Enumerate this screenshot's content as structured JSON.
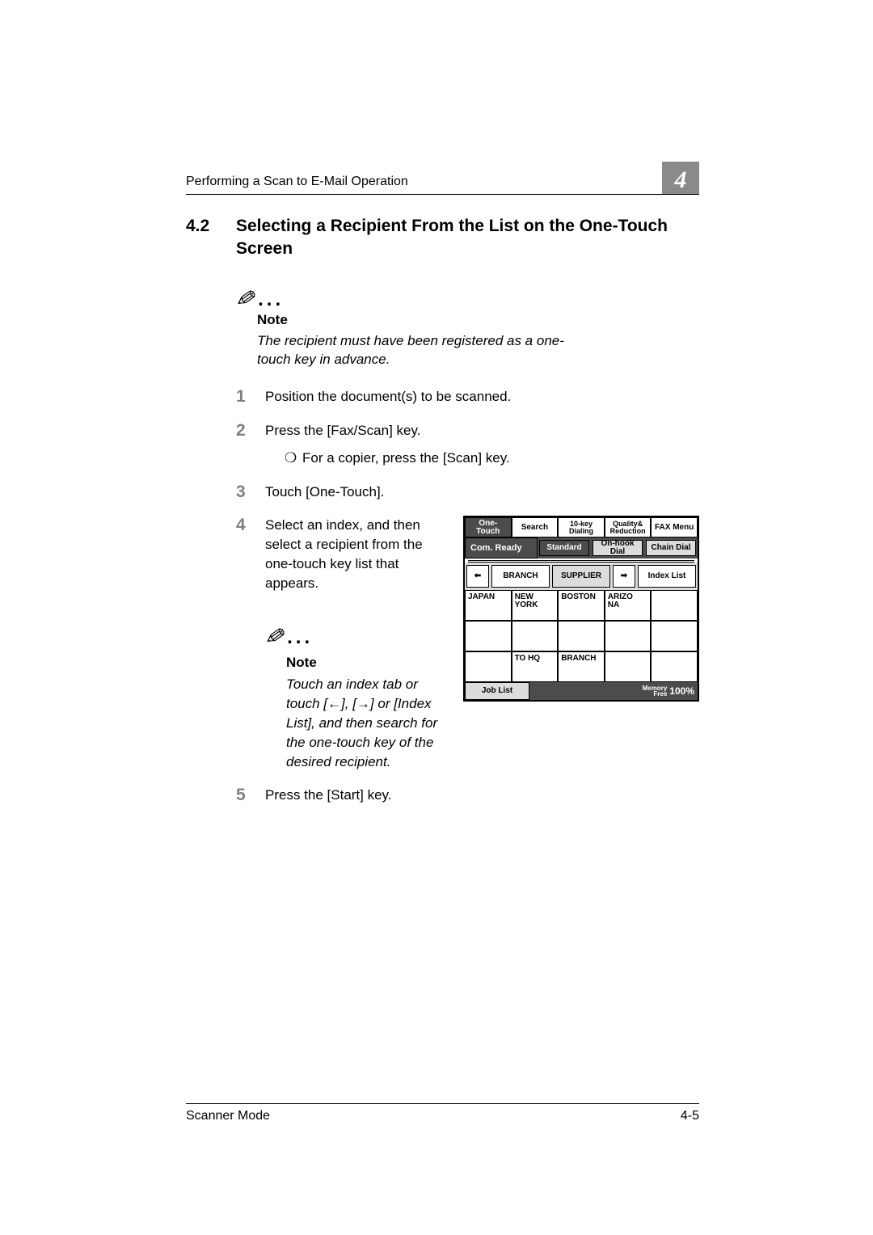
{
  "header": {
    "running": "Performing a Scan to E-Mail Operation",
    "chapter": "4"
  },
  "section": {
    "number": "4.2",
    "title": "Selecting a Recipient From the List on the One-Touch Screen"
  },
  "note1": {
    "label": "Note",
    "text": "The recipient must have been registered as a one-touch key in advance."
  },
  "steps": {
    "s1": {
      "n": "1",
      "t": "Position the document(s) to be scanned."
    },
    "s2": {
      "n": "2",
      "t": "Press the [Fax/Scan] key.",
      "sub": "For a copier, press the [Scan] key."
    },
    "s3": {
      "n": "3",
      "t": "Touch [One-Touch]."
    },
    "s4": {
      "n": "4",
      "t": "Select an index, and then select a recipient from the one-touch key list that appears."
    },
    "s5": {
      "n": "5",
      "t": "Press the [Start] key."
    }
  },
  "note2": {
    "label": "Note",
    "text": "Touch an index tab or touch [←], [→] or [Index List], and then search for the one-touch key of the desired recipient."
  },
  "panel": {
    "tabs": [
      "One-Touch",
      "Search",
      "10-key\nDialing",
      "Quality&\nReduction",
      "FAX Menu"
    ],
    "status": "Com. Ready",
    "pills": [
      "Standard",
      "On-hook Dial",
      "Chain Dial"
    ],
    "nav_prev": "←",
    "nav_a": "BRANCH",
    "nav_b": "SUPPLIER",
    "nav_next": "→",
    "nav_index": "Index List",
    "grid": [
      "JAPAN",
      "NEW\nYORK",
      "BOSTON",
      "ARIZO\nNA",
      "",
      "",
      "",
      "",
      "",
      "",
      "",
      "TO HQ",
      "BRANCH",
      "",
      ""
    ],
    "job_list": "Job List",
    "mem_label_t": "Memory",
    "mem_label_b": "Free",
    "mem_pct": "100%"
  },
  "footer": {
    "left": "Scanner Mode",
    "right": "4-5"
  },
  "bullet_char": "❍",
  "dots": "..."
}
